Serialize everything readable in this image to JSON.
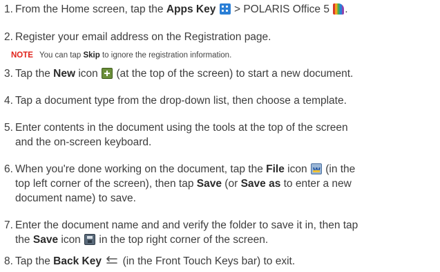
{
  "steps": [
    {
      "num": "1.",
      "t1": "From the Home screen, tap the ",
      "apps_key": "Apps Key",
      "t2": " > ",
      "app_name": "POLARIS Office 5",
      "icons": [
        "apps-key-icon",
        "polaris-office-icon"
      ]
    },
    {
      "num": "2.",
      "text": "Register your email address on the Registration page."
    },
    {
      "num": "3.",
      "t1": "Tap the ",
      "new": "New",
      "t2": " icon ",
      "t3": " (at the top of the screen) to start a new document.",
      "icons": [
        "new-document-icon"
      ]
    },
    {
      "num": "4.",
      "text": "Tap a document type from the drop-down list, then choose a template."
    },
    {
      "num": "5.",
      "line1": "Enter contents in the document using the tools at the top of the screen",
      "line2": "and the on-screen keyboard."
    },
    {
      "num": "6.",
      "t1": "When you're done working on the document, tap the ",
      "file": "File",
      "t2": " icon ",
      "t3": " (in the",
      "line2a": "top left corner of the screen), then tap ",
      "save": "Save",
      "line2b": " (or ",
      "save_as": "Save as",
      "line2c": " to enter a new",
      "line3": "document name) to save.",
      "icons": [
        "file-icon"
      ]
    },
    {
      "num": "7.",
      "line1": "Enter the document name and and verify the folder to save it in, then tap",
      "l2a": "the ",
      "save": "Save",
      "l2b": " icon ",
      "l2c": " in the top right corner of the screen.",
      "icons": [
        "save-icon"
      ]
    },
    {
      "num": "8.",
      "t1": "Tap the ",
      "back_key": "Back Key",
      "t2": " (in the Front Touch Keys bar) to exit.",
      "icons": [
        "back-key-icon"
      ]
    }
  ],
  "note": {
    "label": "NOTE",
    "t1": "You can tap ",
    "skip": "Skip",
    "t2": " to ignore the registration information."
  },
  "colors": {
    "note_label": "#e0231b",
    "apps_key_icon": "#2b7fd6",
    "new_icon": "#6b8f3a"
  }
}
